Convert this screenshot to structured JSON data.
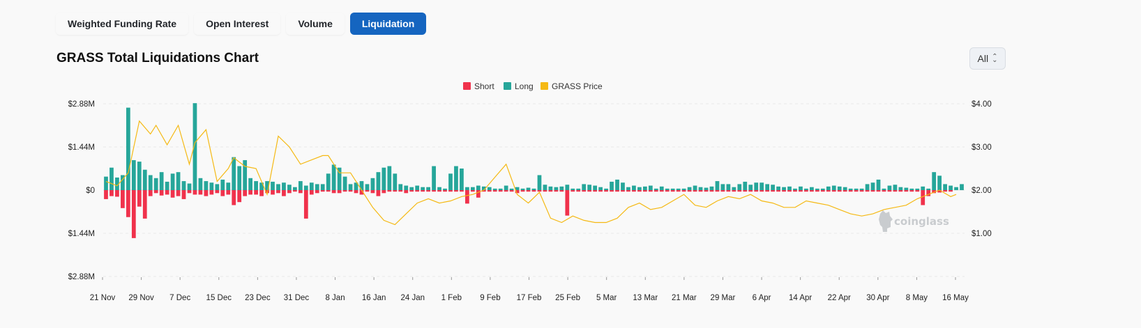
{
  "tabs": [
    {
      "label": "Weighted Funding Rate",
      "active": false
    },
    {
      "label": "Open Interest",
      "active": false
    },
    {
      "label": "Volume",
      "active": false
    },
    {
      "label": "Liquidation",
      "active": true
    }
  ],
  "header": {
    "title": "GRASS Total Liquidations Chart"
  },
  "range_select": {
    "value": "All"
  },
  "watermark": {
    "text": "coinglass"
  },
  "colors": {
    "short": "#f0324c",
    "long": "#26a69a",
    "price": "#f5b914",
    "accent": "#1565c0"
  },
  "chart_data": {
    "type": "bar",
    "legend": [
      "Short",
      "Long",
      "GRASS Price"
    ],
    "legend_position": "top-center",
    "x_labels": [
      "21 Nov",
      "29 Nov",
      "7 Dec",
      "15 Dec",
      "23 Dec",
      "31 Dec",
      "8 Jan",
      "16 Jan",
      "24 Jan",
      "1 Feb",
      "9 Feb",
      "17 Feb",
      "25 Feb",
      "5 Mar",
      "13 Mar",
      "21 Mar",
      "29 Mar",
      "6 Apr",
      "14 Apr",
      "22 Apr",
      "30 Apr",
      "8 May",
      "16 May"
    ],
    "y_left": {
      "ticks": [
        "$2.88M",
        "$1.44M",
        "$0",
        "$1.44M",
        "$2.88M"
      ],
      "range": [
        -2.88,
        2.88
      ],
      "unit": "M USD"
    },
    "y_right": {
      "ticks": [
        "$4.00",
        "$3.00",
        "$2.00",
        "$1.00"
      ],
      "range": [
        0,
        4
      ],
      "unit": "USD"
    },
    "grid": "horizontal-dashed",
    "long": [
      0.45,
      0.75,
      0.42,
      0.5,
      2.75,
      1.0,
      0.95,
      0.68,
      0.5,
      0.4,
      0.6,
      0.28,
      0.55,
      0.6,
      0.3,
      0.22,
      2.9,
      0.4,
      0.3,
      0.25,
      0.2,
      0.35,
      0.25,
      1.1,
      0.8,
      1.0,
      0.4,
      0.3,
      0.25,
      0.3,
      0.28,
      0.2,
      0.25,
      0.18,
      0.1,
      0.3,
      0.15,
      0.25,
      0.2,
      0.2,
      0.55,
      0.85,
      0.75,
      0.45,
      0.2,
      0.25,
      0.3,
      0.2,
      0.4,
      0.6,
      0.75,
      0.8,
      0.55,
      0.2,
      0.15,
      0.1,
      0.15,
      0.1,
      0.1,
      0.8,
      0.1,
      0.05,
      0.55,
      0.8,
      0.72,
      0.1,
      0.1,
      0.15,
      0.12,
      0.1,
      0.05,
      0.05,
      0.15,
      0.05,
      0.1,
      0.05,
      0.08,
      0.05,
      0.5,
      0.18,
      0.12,
      0.1,
      0.12,
      0.18,
      0.05,
      0.05,
      0.2,
      0.18,
      0.15,
      0.1,
      0.05,
      0.28,
      0.35,
      0.25,
      0.1,
      0.15,
      0.1,
      0.12,
      0.15,
      0.05,
      0.12,
      0.05,
      0.05,
      0.05,
      0.05,
      0.1,
      0.15,
      0.1,
      0.08,
      0.12,
      0.3,
      0.2,
      0.2,
      0.1,
      0.2,
      0.28,
      0.18,
      0.25,
      0.25,
      0.2,
      0.18,
      0.12,
      0.1,
      0.12,
      0.05,
      0.12,
      0.05,
      0.1,
      0.05,
      0.05,
      0.12,
      0.15,
      0.12,
      0.1,
      0.05,
      0.05,
      0.05,
      0.2,
      0.25,
      0.35,
      0.05,
      0.15,
      0.18,
      0.1,
      0.08,
      0.05,
      0.05,
      0.12,
      0.05,
      0.6,
      0.48,
      0.2,
      0.15,
      0.1,
      0.2
    ],
    "short": [
      -0.3,
      -0.2,
      -0.22,
      -0.6,
      -0.9,
      -1.6,
      -0.55,
      -0.95,
      -0.2,
      -0.1,
      -0.18,
      -0.15,
      -0.25,
      -0.2,
      -0.3,
      -0.1,
      -0.15,
      -0.15,
      -0.2,
      -0.15,
      -0.1,
      -0.2,
      -0.15,
      -0.5,
      -0.4,
      -0.2,
      -0.15,
      -0.15,
      -0.2,
      -0.1,
      -0.15,
      -0.1,
      -0.2,
      -0.1,
      -0.05,
      -0.1,
      -0.95,
      -0.15,
      -0.1,
      -0.05,
      -0.05,
      -0.1,
      -0.1,
      -0.05,
      -0.05,
      -0.1,
      -0.15,
      -0.05,
      -0.1,
      -0.2,
      -0.1,
      -0.05,
      -0.05,
      -0.05,
      -0.1,
      -0.05,
      -0.05,
      -0.05,
      -0.05,
      -0.05,
      -0.05,
      -0.05,
      -0.05,
      -0.05,
      -0.05,
      -0.45,
      -0.05,
      -0.25,
      -0.05,
      -0.05,
      -0.05,
      -0.05,
      -0.05,
      -0.05,
      -0.1,
      -0.05,
      -0.05,
      -0.05,
      -0.05,
      -0.05,
      -0.05,
      -0.05,
      -0.05,
      -0.85,
      -0.05,
      -0.05,
      -0.05,
      -0.05,
      -0.05,
      -0.05,
      -0.05,
      -0.05,
      -0.05,
      -0.05,
      -0.05,
      -0.05,
      -0.05,
      -0.05,
      -0.05,
      -0.05,
      -0.05,
      -0.05,
      -0.05,
      -0.05,
      -0.05,
      -0.05,
      -0.05,
      -0.05,
      -0.05,
      -0.05,
      -0.05,
      -0.05,
      -0.05,
      -0.05,
      -0.05,
      -0.05,
      -0.05,
      -0.05,
      -0.05,
      -0.05,
      -0.05,
      -0.05,
      -0.05,
      -0.05,
      -0.05,
      -0.05,
      -0.05,
      -0.05,
      -0.05,
      -0.05,
      -0.05,
      -0.05,
      -0.05,
      -0.05,
      -0.05,
      -0.05,
      -0.05,
      -0.05,
      -0.05,
      -0.05,
      -0.05,
      -0.05,
      -0.05,
      -0.05,
      -0.05,
      -0.05,
      -0.05,
      -0.5,
      -0.2,
      -0.1,
      -0.08,
      -0.05,
      -0.05
    ],
    "price": {
      "x_index": [
        0,
        2,
        4,
        6,
        8,
        9,
        11,
        13,
        15,
        16,
        18,
        20,
        22,
        23,
        25,
        27,
        29,
        31,
        33,
        35,
        37,
        39,
        40,
        42,
        44,
        46,
        48,
        50,
        52,
        54,
        56,
        58,
        60,
        62,
        64,
        66,
        68,
        70,
        72,
        74,
        76,
        78,
        80,
        82,
        84,
        86,
        88,
        90,
        92,
        94,
        96,
        98,
        100,
        102,
        104,
        106,
        108,
        110,
        112,
        114,
        116,
        118,
        120,
        122,
        124,
        126,
        128,
        130,
        132,
        134,
        136,
        138,
        140,
        142,
        144,
        146,
        148,
        150,
        152,
        153
      ],
      "values": [
        2.2,
        2.1,
        2.4,
        3.6,
        3.3,
        3.5,
        3.05,
        3.5,
        2.6,
        3.1,
        3.4,
        2.2,
        2.5,
        2.75,
        2.55,
        2.5,
        1.9,
        3.25,
        3.0,
        2.6,
        2.7,
        2.8,
        2.8,
        2.4,
        2.4,
        2.0,
        1.6,
        1.3,
        1.2,
        1.45,
        1.7,
        1.8,
        1.7,
        1.75,
        1.85,
        1.9,
        2.0,
        2.3,
        2.6,
        1.9,
        1.7,
        1.95,
        1.35,
        1.25,
        1.4,
        1.3,
        1.25,
        1.25,
        1.35,
        1.6,
        1.7,
        1.55,
        1.6,
        1.75,
        1.9,
        1.65,
        1.6,
        1.75,
        1.85,
        1.8,
        1.9,
        1.75,
        1.7,
        1.6,
        1.6,
        1.75,
        1.7,
        1.65,
        1.55,
        1.45,
        1.4,
        1.45,
        1.55,
        1.6,
        1.65,
        1.8,
        1.9,
        2.0,
        1.85,
        1.9
      ]
    }
  }
}
